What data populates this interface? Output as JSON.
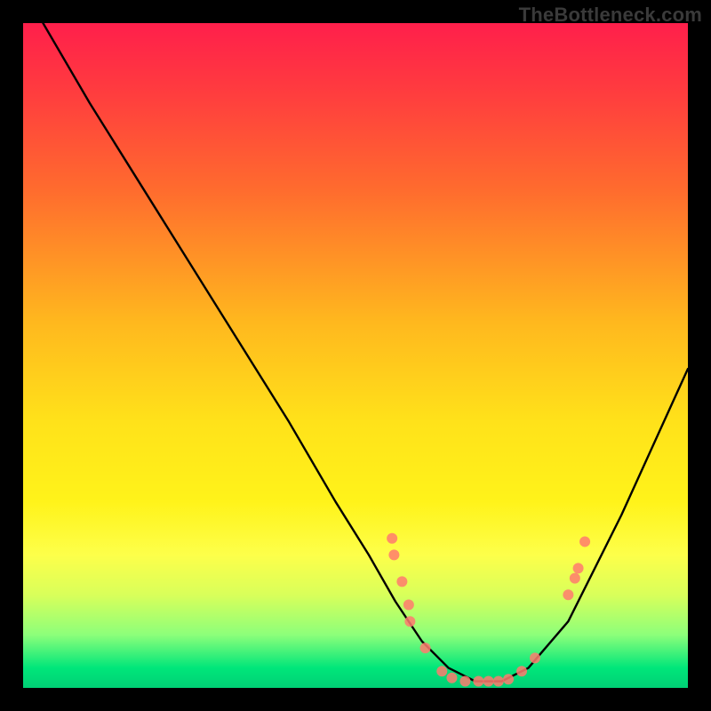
{
  "watermark": "TheBottleneck.com",
  "chart_data": {
    "type": "line",
    "title": "",
    "xlabel": "",
    "ylabel": "",
    "xlim": [
      0,
      100
    ],
    "ylim": [
      0,
      100
    ],
    "x": [
      3,
      10,
      20,
      30,
      40,
      47,
      52,
      56,
      60,
      64,
      68,
      72,
      76,
      82,
      90,
      100
    ],
    "y": [
      100,
      88,
      72,
      56,
      40,
      28,
      20,
      13,
      7,
      3,
      1,
      1,
      3,
      10,
      26,
      48
    ],
    "curve_color": "#000000",
    "marker_color": "#ff7a6e",
    "markers": [
      {
        "x": 55.5,
        "y": 22.5
      },
      {
        "x": 55.8,
        "y": 20.0
      },
      {
        "x": 57.0,
        "y": 16.0
      },
      {
        "x": 58.0,
        "y": 12.5
      },
      {
        "x": 58.2,
        "y": 10.0
      },
      {
        "x": 60.5,
        "y": 6.0
      },
      {
        "x": 63.0,
        "y": 2.5
      },
      {
        "x": 64.5,
        "y": 1.5
      },
      {
        "x": 66.5,
        "y": 1.0
      },
      {
        "x": 68.5,
        "y": 1.0
      },
      {
        "x": 70.0,
        "y": 1.0
      },
      {
        "x": 71.5,
        "y": 1.0
      },
      {
        "x": 73.0,
        "y": 1.3
      },
      {
        "x": 75.0,
        "y": 2.5
      },
      {
        "x": 77.0,
        "y": 4.5
      },
      {
        "x": 82.0,
        "y": 14.0
      },
      {
        "x": 83.0,
        "y": 16.5
      },
      {
        "x": 83.5,
        "y": 18.0
      },
      {
        "x": 84.5,
        "y": 22.0
      }
    ],
    "background": "red-yellow-green vertical gradient"
  }
}
